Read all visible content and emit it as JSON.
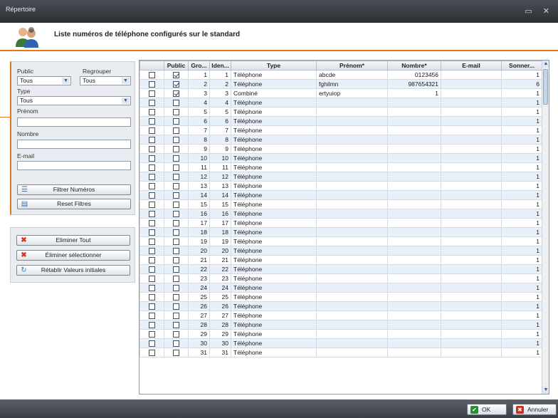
{
  "window": {
    "title": "Répertoire",
    "controls": "▭ ✕"
  },
  "header": {
    "title": "Liste numéros de téléphone configurés sur le standard"
  },
  "filters": {
    "public_label": "Public",
    "public_value": "Tous",
    "regrouper_label": "Regrouper",
    "regrouper_value": "Tous",
    "type_label": "Type",
    "type_value": "Tous",
    "prenom_label": "Prénom",
    "prenom_value": "",
    "nombre_label": "Nombre",
    "nombre_value": "",
    "email_label": "E-mail",
    "email_value": "",
    "filter_button": "Filtrer Numéros",
    "reset_button": "Reset Filtres"
  },
  "actions": {
    "eliminate_all": "Eliminer Tout",
    "eliminate_selected": "Éliminer sélectionner",
    "restore": "Rétablir Valeurs initiales"
  },
  "table": {
    "columns": [
      "",
      "Public",
      "Gro...",
      "Iden...",
      "Type",
      "Prénom*",
      "Nombre*",
      "E-mail",
      "Sonner..."
    ],
    "rows": [
      {
        "sel": false,
        "pub": true,
        "gro": "1",
        "iden": "1",
        "type": "Téléphone",
        "prenom": "abcde",
        "nombre": "0123456",
        "email": "",
        "sonner": "1"
      },
      {
        "sel": false,
        "pub": true,
        "gro": "2",
        "iden": "2",
        "type": "Téléphone",
        "prenom": "fghilmn",
        "nombre": "987654321",
        "email": "",
        "sonner": "6"
      },
      {
        "sel": false,
        "pub": true,
        "gro": "3",
        "iden": "3",
        "type": "Combiné",
        "prenom": "ertyuiop",
        "nombre": "1",
        "email": "",
        "sonner": "1"
      },
      {
        "sel": false,
        "pub": false,
        "gro": "4",
        "iden": "4",
        "type": "Téléphone",
        "prenom": "",
        "nombre": "",
        "email": "",
        "sonner": "1"
      },
      {
        "sel": false,
        "pub": false,
        "gro": "5",
        "iden": "5",
        "type": "Téléphone",
        "prenom": "",
        "nombre": "",
        "email": "",
        "sonner": "1"
      },
      {
        "sel": false,
        "pub": false,
        "gro": "6",
        "iden": "6",
        "type": "Téléphone",
        "prenom": "",
        "nombre": "",
        "email": "",
        "sonner": "1"
      },
      {
        "sel": false,
        "pub": false,
        "gro": "7",
        "iden": "7",
        "type": "Téléphone",
        "prenom": "",
        "nombre": "",
        "email": "",
        "sonner": "1"
      },
      {
        "sel": false,
        "pub": false,
        "gro": "8",
        "iden": "8",
        "type": "Téléphone",
        "prenom": "",
        "nombre": "",
        "email": "",
        "sonner": "1"
      },
      {
        "sel": false,
        "pub": false,
        "gro": "9",
        "iden": "9",
        "type": "Téléphone",
        "prenom": "",
        "nombre": "",
        "email": "",
        "sonner": "1"
      },
      {
        "sel": false,
        "pub": false,
        "gro": "10",
        "iden": "10",
        "type": "Téléphone",
        "prenom": "",
        "nombre": "",
        "email": "",
        "sonner": "1"
      },
      {
        "sel": false,
        "pub": false,
        "gro": "11",
        "iden": "11",
        "type": "Téléphone",
        "prenom": "",
        "nombre": "",
        "email": "",
        "sonner": "1"
      },
      {
        "sel": false,
        "pub": false,
        "gro": "12",
        "iden": "12",
        "type": "Téléphone",
        "prenom": "",
        "nombre": "",
        "email": "",
        "sonner": "1"
      },
      {
        "sel": false,
        "pub": false,
        "gro": "13",
        "iden": "13",
        "type": "Téléphone",
        "prenom": "",
        "nombre": "",
        "email": "",
        "sonner": "1"
      },
      {
        "sel": false,
        "pub": false,
        "gro": "14",
        "iden": "14",
        "type": "Téléphone",
        "prenom": "",
        "nombre": "",
        "email": "",
        "sonner": "1"
      },
      {
        "sel": false,
        "pub": false,
        "gro": "15",
        "iden": "15",
        "type": "Téléphone",
        "prenom": "",
        "nombre": "",
        "email": "",
        "sonner": "1"
      },
      {
        "sel": false,
        "pub": false,
        "gro": "16",
        "iden": "16",
        "type": "Téléphone",
        "prenom": "",
        "nombre": "",
        "email": "",
        "sonner": "1"
      },
      {
        "sel": false,
        "pub": false,
        "gro": "17",
        "iden": "17",
        "type": "Téléphone",
        "prenom": "",
        "nombre": "",
        "email": "",
        "sonner": "1"
      },
      {
        "sel": false,
        "pub": false,
        "gro": "18",
        "iden": "18",
        "type": "Téléphone",
        "prenom": "",
        "nombre": "",
        "email": "",
        "sonner": "1"
      },
      {
        "sel": false,
        "pub": false,
        "gro": "19",
        "iden": "19",
        "type": "Téléphone",
        "prenom": "",
        "nombre": "",
        "email": "",
        "sonner": "1"
      },
      {
        "sel": false,
        "pub": false,
        "gro": "20",
        "iden": "20",
        "type": "Téléphone",
        "prenom": "",
        "nombre": "",
        "email": "",
        "sonner": "1"
      },
      {
        "sel": false,
        "pub": false,
        "gro": "21",
        "iden": "21",
        "type": "Téléphone",
        "prenom": "",
        "nombre": "",
        "email": "",
        "sonner": "1"
      },
      {
        "sel": false,
        "pub": false,
        "gro": "22",
        "iden": "22",
        "type": "Téléphone",
        "prenom": "",
        "nombre": "",
        "email": "",
        "sonner": "1"
      },
      {
        "sel": false,
        "pub": false,
        "gro": "23",
        "iden": "23",
        "type": "Téléphone",
        "prenom": "",
        "nombre": "",
        "email": "",
        "sonner": "1"
      },
      {
        "sel": false,
        "pub": false,
        "gro": "24",
        "iden": "24",
        "type": "Téléphone",
        "prenom": "",
        "nombre": "",
        "email": "",
        "sonner": "1"
      },
      {
        "sel": false,
        "pub": false,
        "gro": "25",
        "iden": "25",
        "type": "Téléphone",
        "prenom": "",
        "nombre": "",
        "email": "",
        "sonner": "1"
      },
      {
        "sel": false,
        "pub": false,
        "gro": "26",
        "iden": "26",
        "type": "Téléphone",
        "prenom": "",
        "nombre": "",
        "email": "",
        "sonner": "1"
      },
      {
        "sel": false,
        "pub": false,
        "gro": "27",
        "iden": "27",
        "type": "Téléphone",
        "prenom": "",
        "nombre": "",
        "email": "",
        "sonner": "1"
      },
      {
        "sel": false,
        "pub": false,
        "gro": "28",
        "iden": "28",
        "type": "Téléphone",
        "prenom": "",
        "nombre": "",
        "email": "",
        "sonner": "1"
      },
      {
        "sel": false,
        "pub": false,
        "gro": "29",
        "iden": "29",
        "type": "Téléphone",
        "prenom": "",
        "nombre": "",
        "email": "",
        "sonner": "1"
      },
      {
        "sel": false,
        "pub": false,
        "gro": "30",
        "iden": "30",
        "type": "Téléphone",
        "prenom": "",
        "nombre": "",
        "email": "",
        "sonner": "1"
      },
      {
        "sel": false,
        "pub": false,
        "gro": "31",
        "iden": "31",
        "type": "Téléphone",
        "prenom": "",
        "nombre": "",
        "email": "",
        "sonner": "1"
      }
    ]
  },
  "footer": {
    "ok": "OK",
    "cancel": "Annuler"
  },
  "colors": {
    "accent": "#e0781c",
    "row_alt": "#e8f1fa",
    "titlebar": "#2a2e33"
  }
}
